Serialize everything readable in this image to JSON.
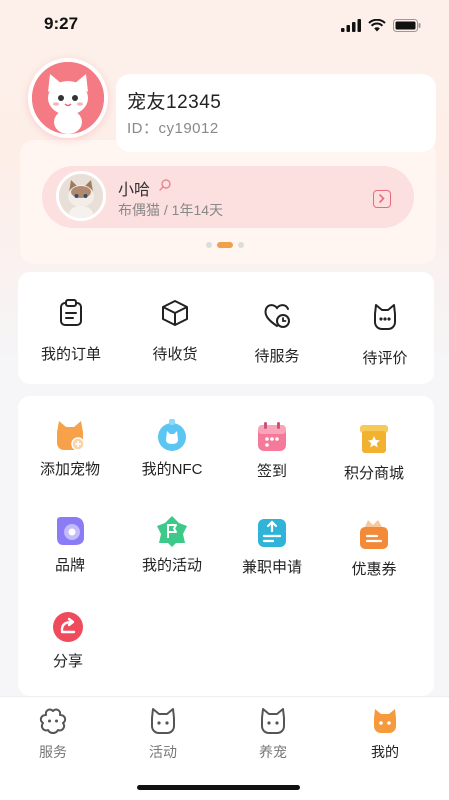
{
  "status_bar": {
    "time": "9:27"
  },
  "profile": {
    "nickname": "宠友12345",
    "user_id": "ID：cy19012"
  },
  "pet": {
    "name": "小哈",
    "info": "布偶猫 / 1年14天"
  },
  "orders": [
    {
      "label": "我的订单",
      "icon": "clipboard-icon"
    },
    {
      "label": "待收货",
      "icon": "box-icon"
    },
    {
      "label": "待服务",
      "icon": "heart-clock-icon"
    },
    {
      "label": "待评价",
      "icon": "cat-chat-icon"
    }
  ],
  "services": [
    {
      "label": "添加宠物",
      "icon": "add-pet-icon"
    },
    {
      "label": "我的NFC",
      "icon": "nfc-tag-icon"
    },
    {
      "label": "签到",
      "icon": "calendar-icon"
    },
    {
      "label": "积分商城",
      "icon": "shop-icon"
    },
    {
      "label": "品牌",
      "icon": "brand-icon"
    },
    {
      "label": "我的活动",
      "icon": "activity-flag-icon"
    },
    {
      "label": "兼职申请",
      "icon": "upload-doc-icon"
    },
    {
      "label": "优惠券",
      "icon": "coupon-icon"
    },
    {
      "label": "分享",
      "icon": "share-icon"
    }
  ],
  "tabs": [
    {
      "label": "服务",
      "icon": "flower-icon",
      "active": false
    },
    {
      "label": "活动",
      "icon": "cat-face-icon",
      "active": false
    },
    {
      "label": "养宠",
      "icon": "cat-outline-icon",
      "active": false
    },
    {
      "label": "我的",
      "icon": "cat-filled-icon",
      "active": true
    }
  ],
  "colors": {
    "accent": "#f0a04b",
    "pink": "#f47b84",
    "pet_card": "#fce0df"
  }
}
